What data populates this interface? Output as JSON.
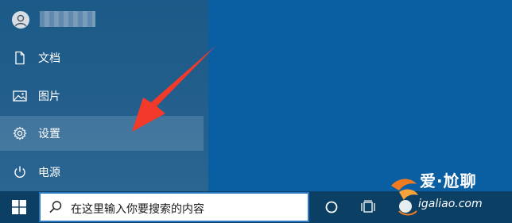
{
  "start_menu": {
    "user": {
      "avatar_icon": "user-icon"
    },
    "items": [
      {
        "label": "文档",
        "icon": "document-icon"
      },
      {
        "label": "图片",
        "icon": "picture-icon"
      },
      {
        "label": "设置",
        "icon": "gear-icon"
      },
      {
        "label": "电源",
        "icon": "power-icon"
      }
    ]
  },
  "taskbar": {
    "start_icon": "windows-logo-icon",
    "search": {
      "placeholder": "在这里输入你要搜索的内容",
      "icon": "search-icon"
    },
    "cortana_icon": "cortana-circle-icon",
    "task_view_icon": "task-view-icon"
  },
  "watermark": {
    "title": "爱·尬聊",
    "domain": "igaliao.com"
  },
  "colors": {
    "desktop": "#0a5fa3",
    "menu": "#245f8d",
    "taskbar": "#0b3f63",
    "search_border": "#2b79c2",
    "arrow": "#f23a2a"
  }
}
